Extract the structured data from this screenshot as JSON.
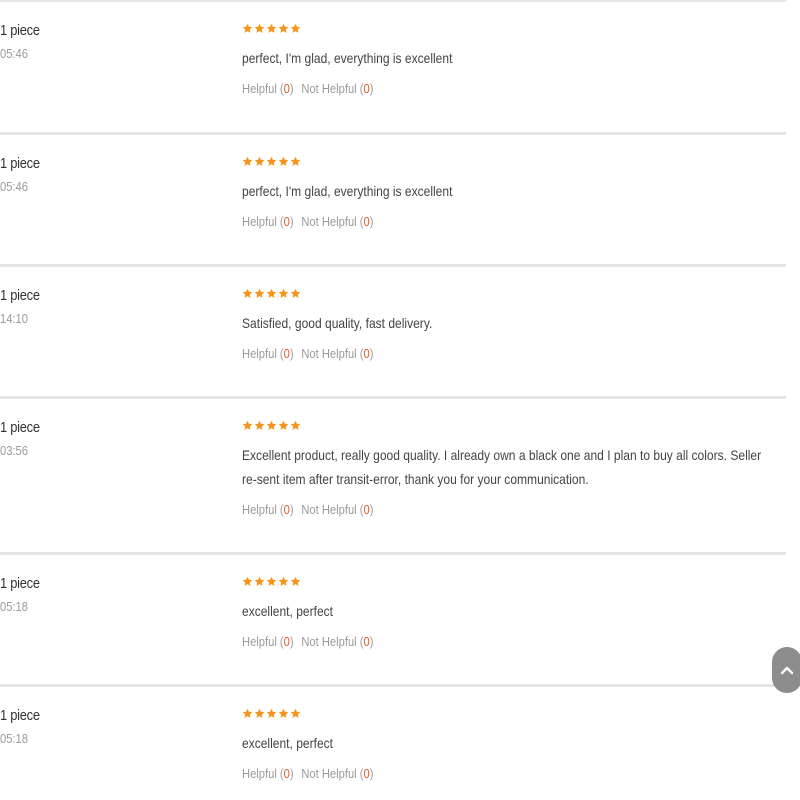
{
  "reviews": [
    {
      "qty": "1 piece",
      "time": "05:46",
      "rating": 5,
      "text": "perfect, I'm glad, everything is excellent",
      "helpful_label": "Helpful",
      "helpful_count": "0",
      "not_helpful_label": "Not Helpful",
      "not_helpful_count": "0"
    },
    {
      "qty": "1 piece",
      "time": "05:46",
      "rating": 5,
      "text": "perfect, I'm glad, everything is excellent",
      "helpful_label": "Helpful",
      "helpful_count": "0",
      "not_helpful_label": "Not Helpful",
      "not_helpful_count": "0"
    },
    {
      "qty": "1 piece",
      "time": "14:10",
      "rating": 5,
      "text": "Satisfied, good quality, fast delivery.",
      "helpful_label": "Helpful",
      "helpful_count": "0",
      "not_helpful_label": "Not Helpful",
      "not_helpful_count": "0"
    },
    {
      "qty": "1 piece",
      "time": "03:56",
      "rating": 5,
      "text": "Excellent product, really good quality. I already own a black one and I plan to buy all colors. Seller re-sent item after transit-error, thank you for your communication.",
      "helpful_label": "Helpful",
      "helpful_count": "0",
      "not_helpful_label": "Not Helpful",
      "not_helpful_count": "0"
    },
    {
      "qty": "1 piece",
      "time": "05:18",
      "rating": 5,
      "text": "excellent, perfect",
      "helpful_label": "Helpful",
      "helpful_count": "0",
      "not_helpful_label": "Not Helpful",
      "not_helpful_count": "0"
    },
    {
      "qty": "1 piece",
      "time": "05:18",
      "rating": 5,
      "text": "excellent, perfect",
      "helpful_label": "Helpful",
      "helpful_count": "0",
      "not_helpful_label": "Not Helpful",
      "not_helpful_count": "0"
    }
  ],
  "icons": {
    "star": "star-icon",
    "scroll_top": "chevron-up-icon"
  },
  "colors": {
    "star": "#f7941d",
    "count": "#e05a2b",
    "scroll_button": "#8d8d8d"
  }
}
